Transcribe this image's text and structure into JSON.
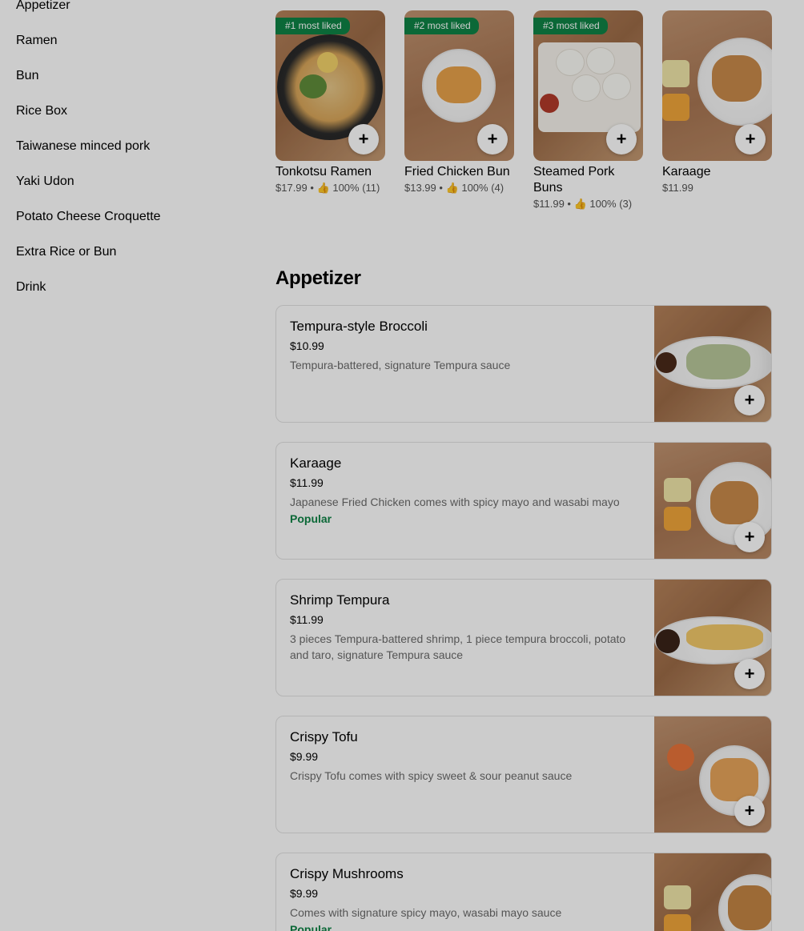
{
  "sidebar": {
    "items": [
      {
        "label": "Appetizer"
      },
      {
        "label": "Ramen"
      },
      {
        "label": "Bun"
      },
      {
        "label": "Rice Box"
      },
      {
        "label": "Taiwanese minced pork"
      },
      {
        "label": "Yaki Udon"
      },
      {
        "label": "Potato Cheese Croquette"
      },
      {
        "label": "Extra Rice or Bun"
      },
      {
        "label": "Drink"
      }
    ]
  },
  "most_liked": [
    {
      "badge": "#1 most liked",
      "name": "Tonkotsu Ramen",
      "meta": "$17.99 • 👍 100% (11)"
    },
    {
      "badge": "#2 most liked",
      "name": "Fried Chicken Bun",
      "meta": "$13.99 • 👍 100% (4)"
    },
    {
      "badge": "#3 most liked",
      "name": "Steamed Pork Buns",
      "meta": "$11.99 • 👍 100% (3)"
    },
    {
      "badge": "",
      "name": "Karaage",
      "meta": "$11.99"
    }
  ],
  "section": {
    "title": "Appetizer"
  },
  "items": [
    {
      "title": "Tempura-style Broccoli",
      "price": "$10.99",
      "desc": "Tempura-battered, signature Tempura sauce",
      "tag": ""
    },
    {
      "title": "Karaage",
      "price": "$11.99",
      "desc": "Japanese Fried Chicken comes with spicy mayo and wasabi mayo",
      "tag": "Popular"
    },
    {
      "title": "Shrimp Tempura",
      "price": "$11.99",
      "desc": "3 pieces Tempura-battered shrimp, 1 piece tempura broccoli, potato and taro, signature Tempura sauce",
      "tag": ""
    },
    {
      "title": "Crispy Tofu",
      "price": "$9.99",
      "desc": "Crispy Tofu comes with spicy sweet & sour peanut sauce",
      "tag": ""
    },
    {
      "title": "Crispy Mushrooms",
      "price": "$9.99",
      "desc": "Comes with signature spicy mayo, wasabi mayo sauce",
      "tag": "Popular"
    }
  ],
  "add_button": {
    "icon": "+"
  },
  "colors": {
    "accent_green": "#0e8345",
    "overlay": "rgba(0,0,0,0.2)"
  }
}
